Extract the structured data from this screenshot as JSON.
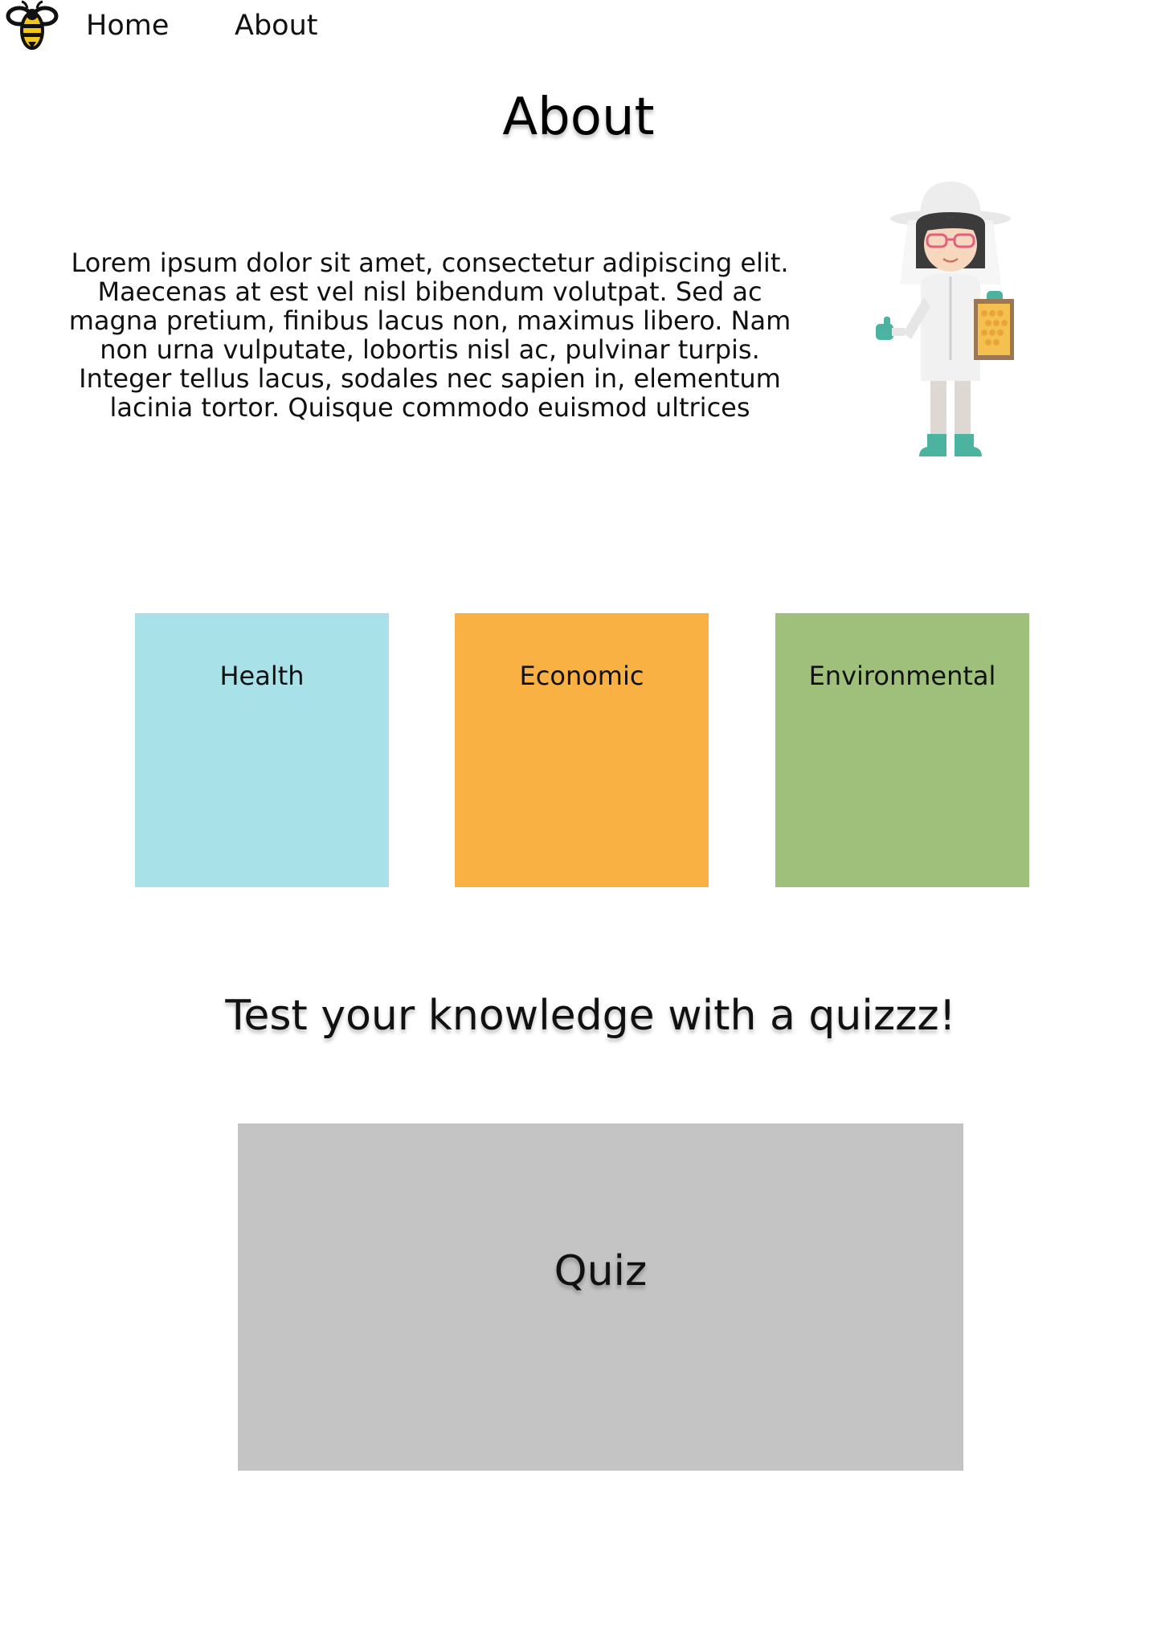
{
  "nav": {
    "logo_icon": "bee-icon",
    "links": [
      {
        "label": "Home"
      },
      {
        "label": "About"
      }
    ]
  },
  "page": {
    "title": "About"
  },
  "intro": {
    "text": "Lorem ipsum dolor sit amet, consectetur adipiscing elit. Maecenas at est vel nisl bibendum volutpat. Sed ac magna pretium, finibus lacus non, maximus libero. Nam non urna vulputate, lobortis nisl ac, pulvinar turpis. Integer tellus lacus, sodales nec sapien in, elementum lacinia tortor. Quisque commodo euismod ultrices",
    "illustration_icon": "beekeeper-illustration"
  },
  "categories": [
    {
      "label": "Health",
      "color": "#a8e1e8"
    },
    {
      "label": "Economic",
      "color": "#f9b143"
    },
    {
      "label": "Environmental",
      "color": "#9fc07b"
    }
  ],
  "quiz": {
    "heading": "Test your knowledge with a quizzz!",
    "button_label": "Quiz",
    "color": "#c4c4c4"
  }
}
